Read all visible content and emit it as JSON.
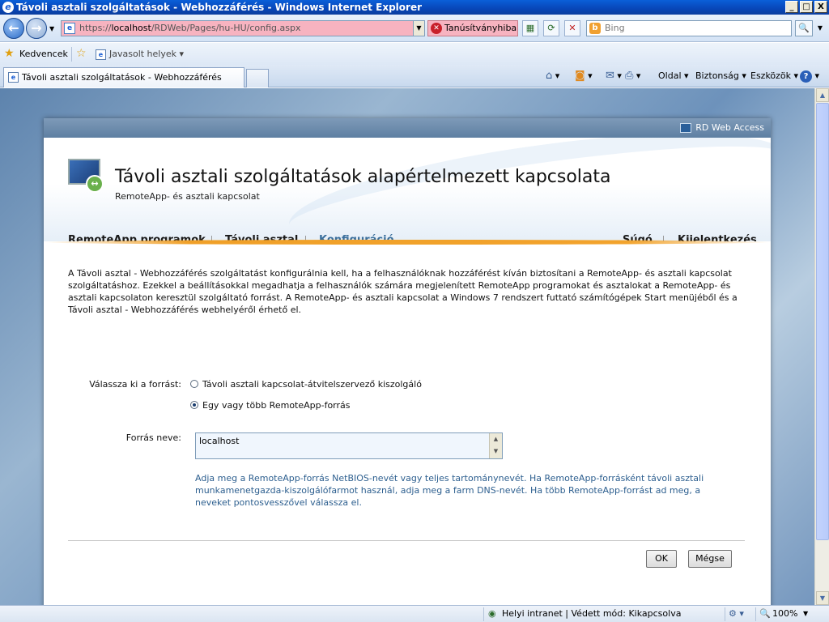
{
  "window": {
    "title": "Távoli asztali szolgáltatások - Webhozzáférés - Windows Internet Explorer",
    "btn_min": "_",
    "btn_max": "□",
    "btn_close": "X"
  },
  "addressbar": {
    "url_prefix": "https://",
    "url_host": "localhost",
    "url_path": "/RDWeb/Pages/hu-HU/config.aspx",
    "cert_error": "Tanúsítványhiba",
    "search_placeholder": "Bing"
  },
  "favorites": {
    "label": "Kedvencek",
    "suggested": "Javasolt helyek ▾"
  },
  "tab": {
    "title": "Távoli asztali szolgáltatások - Webhozzáférés"
  },
  "commandbar": {
    "page": "Oldal ▾",
    "safety": "Biztonság ▾",
    "tools": "Eszközök ▾"
  },
  "rdweb": {
    "header_label": "RD Web Access",
    "title": "Távoli asztali szolgáltatások alapértelmezett kapcsolata",
    "subtitle": "RemoteApp- és asztali kapcsolat",
    "nav": {
      "remoteapp": "RemoteApp programok",
      "desktop": "Távoli asztal",
      "config": "Konfiguráció",
      "help": "Súgó",
      "logout": "Kijelentkezés"
    },
    "intro": "A Távoli asztal - Webhozzáférés szolgáltatást konfigurálnia kell, ha a felhasználóknak hozzáférést kíván biztosítani a RemoteApp- és asztali kapcsolat szolgáltatáshoz. Ezekkel a beállításokkal megadhatja a felhasználók számára megjelenített RemoteApp programokat és asztalokat a RemoteApp- és asztali kapcsolaton keresztül szolgáltató forrást. A RemoteApp- és asztali kapcsolat a Windows 7 rendszert futtató számítógépek Start menüjéből és a Távoli asztal - Webhozzáférés webhelyéről érhető el.",
    "form": {
      "source_label": "Válassza ki a forrást:",
      "option1": "Távoli asztali kapcsolat-átvitelszervező kiszolgáló",
      "option2": "Egy vagy több RemoteApp-forrás",
      "selected_option": 2,
      "name_label": "Forrás neve:",
      "name_value": "localhost",
      "help": "Adja meg a RemoteApp-forrás NetBIOS-nevét vagy teljes tartománynevét. Ha RemoteApp-forrásként távoli asztali munkamenetgazda-kiszolgálófarmot használ, adja meg a farm DNS-nevét. Ha több RemoteApp-forrást ad meg, a neveket pontosvesszővel válassza el.",
      "ok": "OK",
      "cancel": "Mégse"
    }
  },
  "statusbar": {
    "zone": "Helyi intranet | Védett mód: Kikapcsolva",
    "zoom": "100%"
  }
}
